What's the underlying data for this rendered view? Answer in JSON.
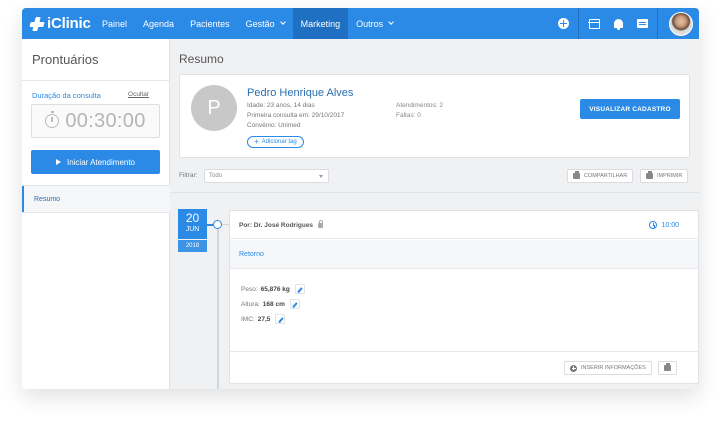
{
  "app": {
    "name": "iClinic"
  },
  "nav": {
    "items": [
      "Painel",
      "Agenda",
      "Pacientes",
      "Gestão",
      "Marketing",
      "Outros"
    ],
    "active": "Marketing"
  },
  "topbar_icons": [
    "plus-circle-icon",
    "gift-icon",
    "bell-icon",
    "chat-icon",
    "user-avatar"
  ],
  "sidebar": {
    "title": "Prontuários",
    "duration_label": "Duração da consulta",
    "hide_label": "Ocultar",
    "timer": "00:30:00",
    "start_button": "Iniciar Atendimento",
    "items": [
      "Resumo"
    ]
  },
  "main": {
    "title": "Resumo",
    "patient": {
      "initial": "P",
      "name": "Pedro Henrique Alves",
      "age": "Idade: 23 anos, 14 dias",
      "first_visit": "Primeira consulta em: 29/10/2017",
      "insurance": "Convênio: Unimed",
      "add_tag": "Adicionar tag",
      "appointments": "Atendimentos: 2",
      "absences": "Faltas: 0",
      "view_button": "VISUALIZAR CADASTRO"
    },
    "filter": {
      "label": "Filtrar:",
      "value": "Todo",
      "share": "COMPARTILHAR",
      "print": "IMPRIMIR"
    },
    "timeline": {
      "day": "20",
      "month": "JUN",
      "year": "2018",
      "by": "Por: Dr. José Rodrigues",
      "time": "10:00",
      "section": "Retorno",
      "measurements": [
        {
          "label": "Peso:",
          "value": "65,876 kg"
        },
        {
          "label": "Altura:",
          "value": "168 cm"
        },
        {
          "label": "IMC:",
          "value": "27,5"
        }
      ],
      "insert_button": "INSERIR INFORMAÇÕES"
    }
  },
  "colors": {
    "primary": "#2a8ae6",
    "nav_active": "#1f6fc2",
    "background": "#f0f1f3"
  }
}
